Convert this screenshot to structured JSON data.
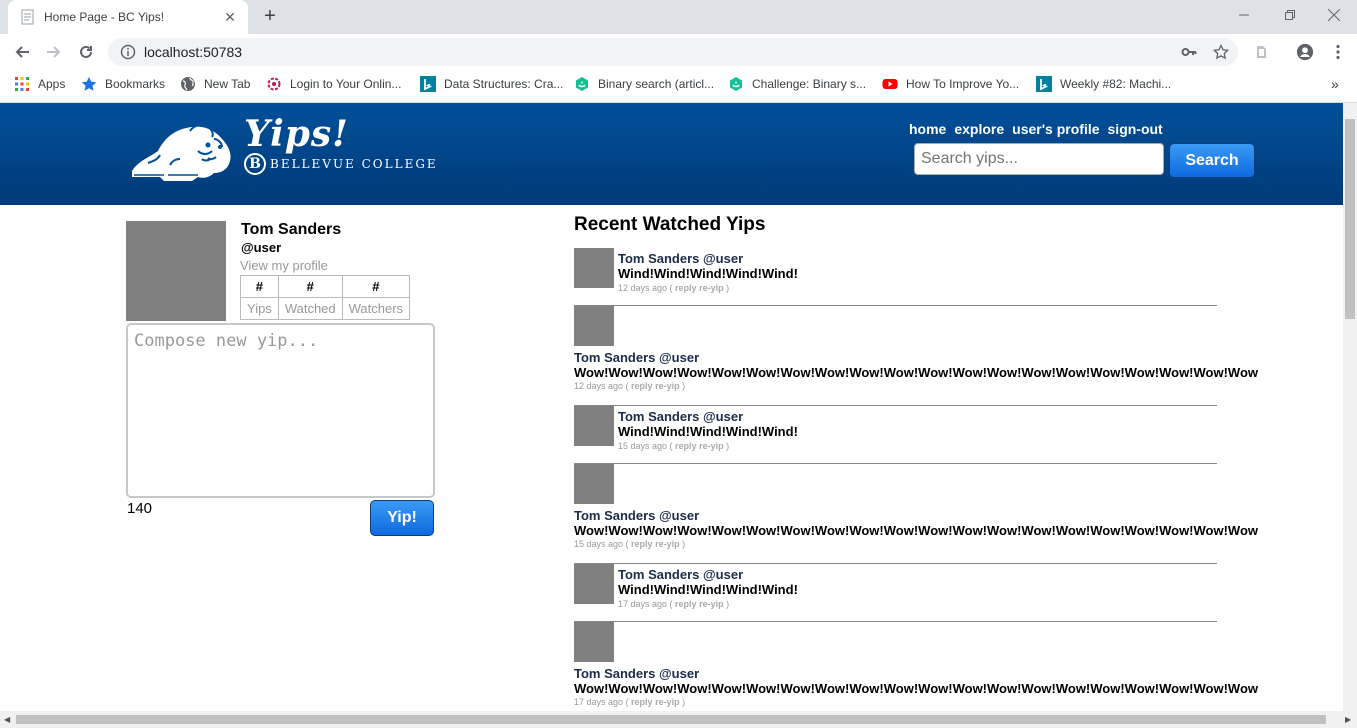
{
  "browser": {
    "tab_title": "Home Page - BC Yips!",
    "url": "localhost:50783",
    "bookmarks": [
      {
        "label": "Apps",
        "icon": "apps-grid-icon"
      },
      {
        "label": "Bookmarks",
        "icon": "star-icon"
      },
      {
        "label": "New Tab",
        "icon": "globe-icon"
      },
      {
        "label": "Login to Your Onlin...",
        "icon": "flower-icon"
      },
      {
        "label": "Data Structures: Cra...",
        "icon": "bing-icon"
      },
      {
        "label": "Binary search (articl...",
        "icon": "khan-academy-icon"
      },
      {
        "label": "Challenge: Binary s...",
        "icon": "khan-academy-icon"
      },
      {
        "label": "How To Improve Yo...",
        "icon": "youtube-icon"
      },
      {
        "label": "Weekly #82: Machi...",
        "icon": "bing-icon"
      }
    ],
    "overflow": "»"
  },
  "site": {
    "logo_text": "Yips!",
    "college_name": "BELLEVUE COLLEGE",
    "college_initial": "B",
    "nav": [
      "home",
      "explore",
      "user's profile",
      "sign-out"
    ],
    "search_placeholder": "Search yips...",
    "search_button": "Search",
    "brand_color": "#01509a"
  },
  "profile": {
    "name": "Tom Sanders",
    "handle": "@user",
    "view_link": "View my profile",
    "stats": [
      {
        "value": "#",
        "label": "Yips"
      },
      {
        "value": "#",
        "label": "Watched"
      },
      {
        "value": "#",
        "label": "Watchers"
      }
    ]
  },
  "compose": {
    "placeholder": "Compose new yip...",
    "remaining": "140",
    "submit": "Yip!"
  },
  "feed": {
    "title": "Recent Watched Yips",
    "reply_label": "reply",
    "reyip_label": "re-yip",
    "items": [
      {
        "author": "Tom Sanders @user",
        "text": "Wind!Wind!Wind!Wind!Wind!",
        "time": "12 days ago",
        "layout": "short"
      },
      {
        "author": "Tom Sanders @user",
        "text": "Wow!Wow!Wow!Wow!Wow!Wow!Wow!Wow!Wow!Wow!Wow!Wow!Wow!Wow!Wow!Wow!Wow!Wow!Wow!Wow",
        "time": "12 days ago",
        "layout": "long"
      },
      {
        "author": "Tom Sanders @user",
        "text": "Wind!Wind!Wind!Wind!Wind!",
        "time": "15 days ago",
        "layout": "short"
      },
      {
        "author": "Tom Sanders @user",
        "text": "Wow!Wow!Wow!Wow!Wow!Wow!Wow!Wow!Wow!Wow!Wow!Wow!Wow!Wow!Wow!Wow!Wow!Wow!Wow!Wow",
        "time": "15 days ago",
        "layout": "long"
      },
      {
        "author": "Tom Sanders @user",
        "text": "Wind!Wind!Wind!Wind!Wind!",
        "time": "17 days ago",
        "layout": "short"
      },
      {
        "author": "Tom Sanders @user",
        "text": "Wow!Wow!Wow!Wow!Wow!Wow!Wow!Wow!Wow!Wow!Wow!Wow!Wow!Wow!Wow!Wow!Wow!Wow!Wow!Wow",
        "time": "17 days ago",
        "layout": "long"
      }
    ]
  }
}
